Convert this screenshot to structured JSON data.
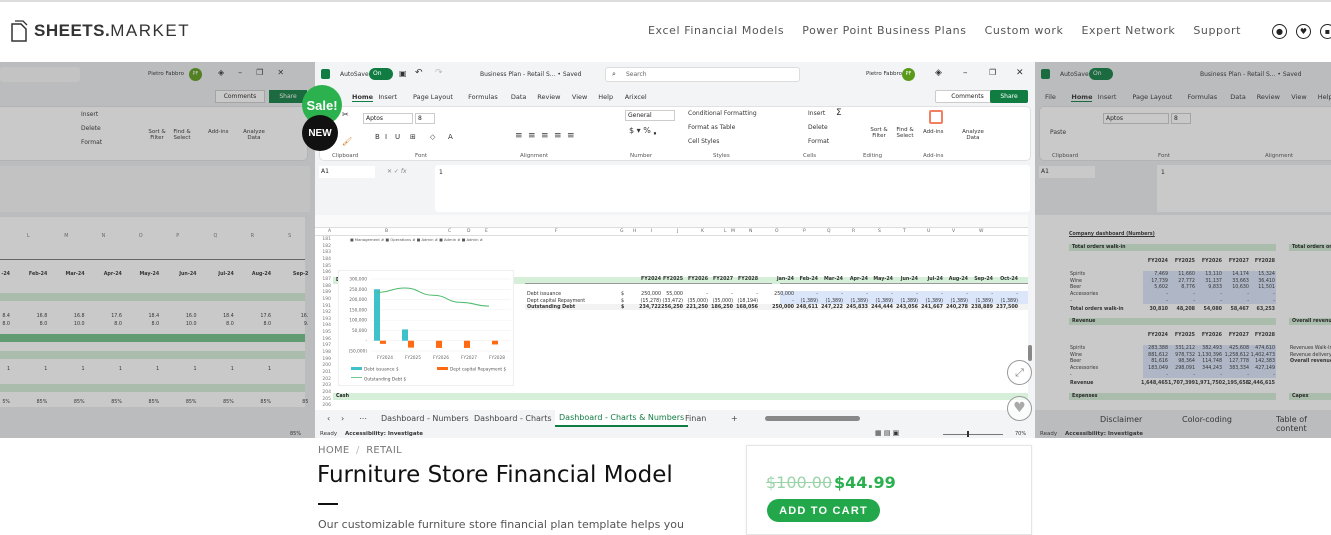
{
  "header": {
    "logo_bold": "SHEETS.",
    "logo_thin": "MARKET",
    "nav": [
      "Excel Financial Models",
      "Power Point Business Plans",
      "Custom work",
      "Expert Network",
      "Support"
    ],
    "icons": [
      "user-icon",
      "heart-icon",
      "cart-icon"
    ]
  },
  "badges": {
    "sale": "Sale!",
    "new": "NEW"
  },
  "excel": {
    "autosave": "AutoSave",
    "toggle": "On",
    "doc_title": "Business Plan - Retail S... • Saved",
    "search": "Search",
    "user": "Pietro Fabbro",
    "initials": "PF",
    "tabs": [
      "File",
      "Home",
      "Insert",
      "Page Layout",
      "Formulas",
      "Data",
      "Review",
      "View",
      "Help",
      "Arixcel"
    ],
    "comments": "Comments",
    "share": "Share",
    "font": "Aptos",
    "font_size": "8",
    "number_format": "General",
    "styles": [
      "Conditional Formatting",
      "Format as Table",
      "Cell Styles"
    ],
    "cells": [
      "Insert",
      "Delete",
      "Format"
    ],
    "editing": [
      "Sort & Filter",
      "Find & Select"
    ],
    "addins": "Add-ins",
    "analyze": "Analyze Data",
    "paste": "Paste",
    "groups": [
      "Clipboard",
      "Font",
      "Alignment",
      "Number",
      "Styles",
      "Cells",
      "Editing",
      "Add-ins"
    ],
    "namebox": "A1",
    "formula": "1",
    "columns": [
      "A",
      "B",
      "C",
      "D",
      "E",
      "F",
      "G",
      "H",
      "I",
      "J",
      "K",
      "L",
      "M",
      "N",
      "O",
      "P",
      "Q",
      "R",
      "S",
      "T",
      "U",
      "V",
      "W"
    ],
    "rows": [
      "181",
      "182",
      "183",
      "184",
      "185",
      "186",
      "187",
      "188",
      "189",
      "190",
      "191",
      "192",
      "193",
      "194",
      "195",
      "196",
      "197",
      "198",
      "199",
      "200",
      "201",
      "202",
      "203",
      "204",
      "205",
      "206"
    ],
    "legend_top": "■ Management # ■ Operations # ■ Admin # ■ Admin # ■ Admin #",
    "sections": {
      "debt": "Debt",
      "cash": "Cash"
    },
    "debt_table": {
      "years": [
        "FY2024",
        "FY2025",
        "FY2026",
        "FY2027",
        "FY2028"
      ],
      "months": [
        "Jan-24",
        "Feb-24",
        "Mar-24",
        "Apr-24",
        "May-24",
        "Jun-24",
        "Jul-24",
        "Aug-24",
        "Sep-24",
        "Oct-24"
      ],
      "rows": [
        {
          "label": "Debt issuance",
          "unit": "$",
          "years": [
            "250,000",
            "55,000",
            "-",
            "-",
            "-"
          ],
          "months": [
            "250,000",
            "-",
            "-",
            "-",
            "-",
            "-",
            "-",
            "-",
            "-",
            "-"
          ]
        },
        {
          "label": "Dept capital Repayment",
          "unit": "$",
          "years": [
            "(15,278)",
            "(33,472)",
            "(35,000)",
            "(35,000)",
            "(18,194)"
          ],
          "months": [
            "-",
            "(1,389)",
            "(1,389)",
            "(1,389)",
            "(1,389)",
            "(1,389)",
            "(1,389)",
            "(1,389)",
            "(1,389)",
            "(1,389)"
          ]
        },
        {
          "label": "Outstanding Debt",
          "unit": "$",
          "years": [
            "234,722",
            "256,250",
            "221,250",
            "186,250",
            "168,056"
          ],
          "months": [
            "250,000",
            "248,611",
            "247,222",
            "245,833",
            "244,444",
            "243,056",
            "241,667",
            "240,278",
            "238,889",
            "237,500"
          ]
        }
      ]
    },
    "debt_chart": {
      "type": "bar",
      "categories": [
        "FY2024",
        "FY2025",
        "FY2026",
        "FY2027",
        "FY2028"
      ],
      "ylim": [
        -50000,
        300000
      ],
      "yticks": [
        "300,000",
        "250,000",
        "200,000",
        "150,000",
        "100,000",
        "50,000",
        "-",
        "(50,000)"
      ],
      "series": [
        {
          "name": "Debt issuance $",
          "kind": "bar",
          "color": "#3fc1c9",
          "values": [
            250000,
            55000,
            0,
            0,
            0
          ]
        },
        {
          "name": "Dept capital Repayment $",
          "kind": "bar",
          "color": "#ff6a13",
          "values": [
            -15278,
            -33472,
            -35000,
            -35000,
            -18194
          ]
        },
        {
          "name": "Outstanding Debt $",
          "kind": "line",
          "color": "#4cbb6c",
          "values": [
            234722,
            256250,
            221250,
            186250,
            168056
          ]
        }
      ]
    },
    "sheet_tabs": [
      "Dashboard - Numbers",
      "Dashboard - Charts",
      "Dashboard - Charts & Numbers",
      "Finan"
    ],
    "active_sheet": "Dashboard - Charts & Numbers",
    "status": "Ready",
    "accessibility": "Accessibility: Investigate",
    "zoom": "70%"
  },
  "left_panel": {
    "months": [
      "-24",
      "Feb-24",
      "Mar-24",
      "Apr-24",
      "May-24",
      "Jun-24",
      "Jul-24",
      "Aug-24",
      "Sep-2"
    ],
    "cols": [
      "L",
      "M",
      "N",
      "O",
      "P",
      "Q",
      "R",
      "S"
    ],
    "row1": [
      "8.4",
      "16.8",
      "16.8",
      "17.6",
      "18.4",
      "16.0",
      "18.4",
      "17.6",
      "16."
    ],
    "row2": [
      "8.0",
      "8.0",
      "10.0",
      "8.0",
      "8.0",
      "10.0",
      "8.0",
      "8.0",
      "9."
    ],
    "row3": [
      "1",
      "1",
      "1",
      "1",
      "1",
      "1",
      "1",
      "1",
      ""
    ],
    "row4": [
      "5%",
      "85%",
      "85%",
      "85%",
      "85%",
      "85%",
      "85%",
      "85%",
      "85"
    ],
    "zoom": "85%"
  },
  "right_panel": {
    "title": "Company dashboard (Numbers)",
    "s1": "Total orders walk-in",
    "s2": "Revenue",
    "s3": "Expenses",
    "s1b": "Total orders onlin",
    "s2b": "Overall revenues",
    "s3b": "Capex",
    "years": [
      "FY2024",
      "FY2025",
      "FY2026",
      "FY2027",
      "FY2028"
    ],
    "orders": [
      [
        "Spirits",
        "7,469",
        "11,660",
        "13,110",
        "14,174",
        "15,324"
      ],
      [
        "Wine",
        "17,739",
        "27,772",
        "31,137",
        "33,663",
        "36,410"
      ],
      [
        "Beer",
        "5,602",
        "8,776",
        "9,833",
        "10,630",
        "11,501"
      ],
      [
        "Accessories",
        "-",
        "-",
        "-",
        "-",
        "-"
      ],
      [
        "-",
        "-",
        "-",
        "-",
        "-",
        "-"
      ]
    ],
    "orders_total": [
      "Total orders walk-in",
      "30,810",
      "48,208",
      "54,080",
      "58,467",
      "63,253"
    ],
    "revenue": [
      [
        "Spirits",
        "283,388",
        "331,212",
        "382,493",
        "425,608",
        "474,610"
      ],
      [
        "Wine",
        "881,612",
        "978,732",
        "1,130,396",
        "1,258,612",
        "1,402,473"
      ],
      [
        "Beer",
        "81,616",
        "98,364",
        "114,748",
        "127,778",
        "142,383"
      ],
      [
        "Accessories",
        "183,049",
        "298,091",
        "344,243",
        "383,334",
        "427,149"
      ],
      [
        "-",
        "-",
        "-",
        "-",
        "-",
        "-"
      ]
    ],
    "revenue_total": [
      "Revenue",
      "1,648,465",
      "1,707,399",
      "1,971,750",
      "2,195,658",
      "2,446,615"
    ],
    "rev_side": [
      "Revenues Walk-In",
      "Revenue delivery a",
      "Overall revenues"
    ],
    "sheet_tabs": [
      "Disclaimer",
      "Color-coding",
      "Table of content",
      "Inputs",
      "Da"
    ]
  },
  "product": {
    "breadcrumb_home": "HOME",
    "breadcrumb_sep": "/",
    "breadcrumb_cat": "RETAIL",
    "title": "Furniture Store Financial Model",
    "description": "Our customizable furniture store financial plan template helps you",
    "old_price": "$100.00",
    "price": "$44.99",
    "cart": "ADD TO CART"
  },
  "colors": {
    "excel_green": "#107c41",
    "accent": "#22a84a",
    "sale": "#2bb14d"
  }
}
